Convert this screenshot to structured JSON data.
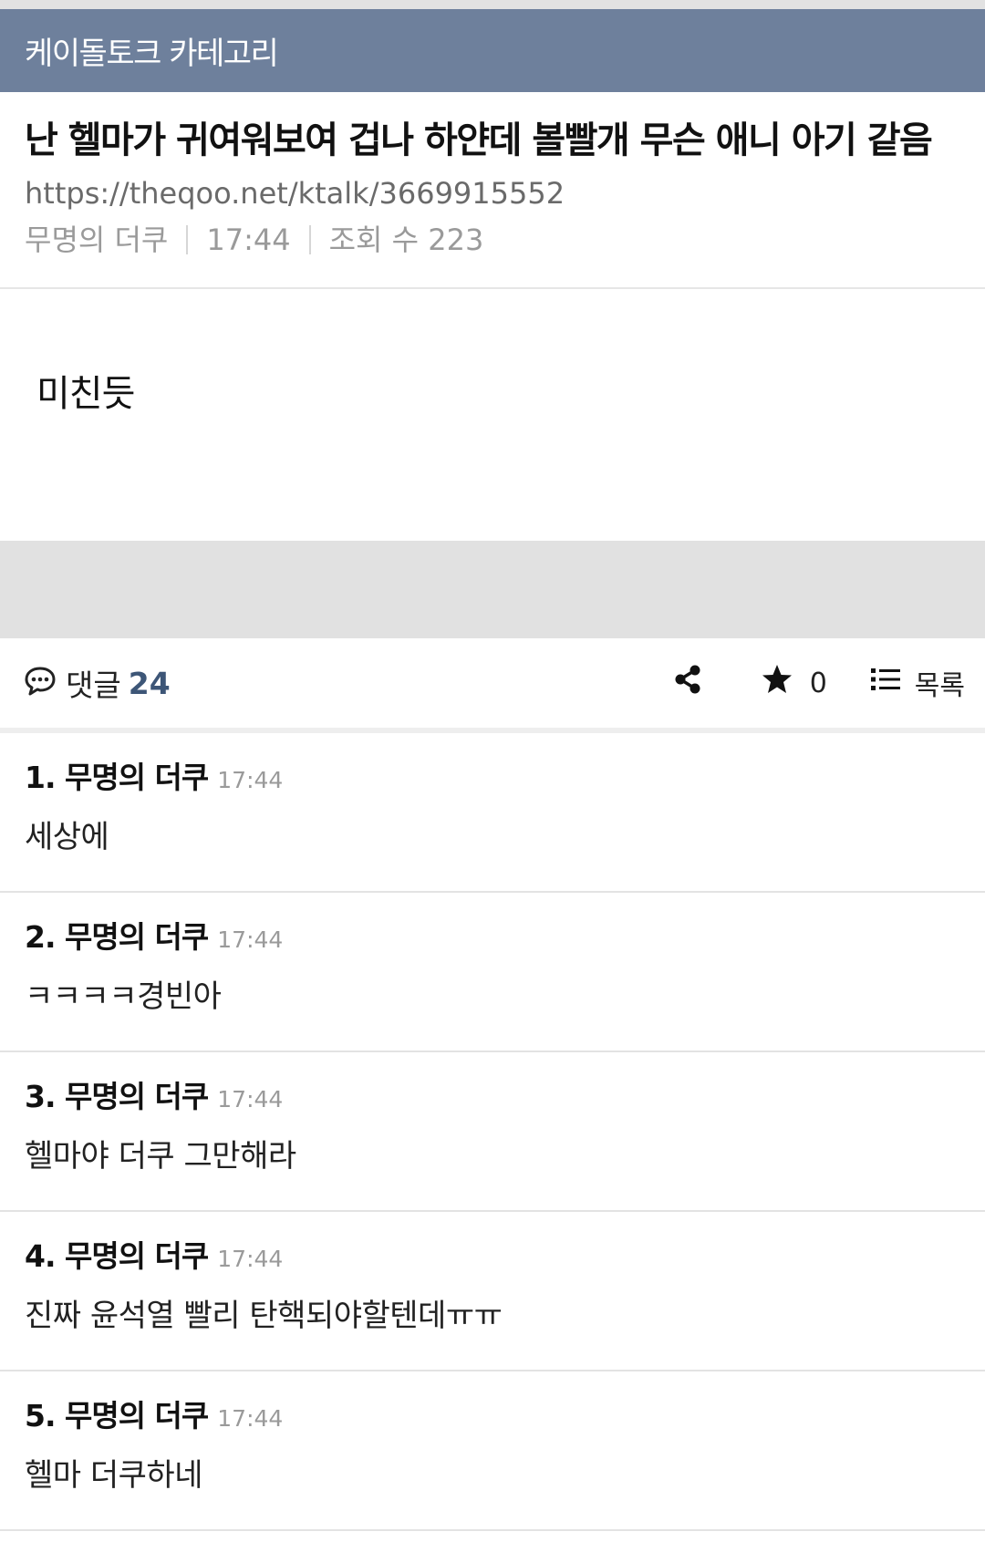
{
  "category": {
    "title": "케이돌토크 카테고리"
  },
  "post": {
    "title": "난 헬마가 귀여워보여 겁나 하얀데 볼빨개 무슨 애니 아기 같음",
    "url": "https://theqoo.net/ktalk/3669915552",
    "author": "무명의 더쿠",
    "time": "17:44",
    "views": "조회 수 223",
    "body": "미친듯"
  },
  "actions": {
    "comment_label": "댓글",
    "comment_count": "24",
    "star_count": "0",
    "list_label": "목록",
    "icons": [
      "comment-icon",
      "share-icon",
      "star-icon",
      "list-icon"
    ]
  },
  "comments": [
    {
      "author": "1. 무명의 더쿠",
      "time": "17:44",
      "text": "세상에"
    },
    {
      "author": "2. 무명의 더쿠",
      "time": "17:44",
      "text": "ㅋㅋㅋㅋ경빈아"
    },
    {
      "author": "3. 무명의 더쿠",
      "time": "17:44",
      "text": "헬마야 더쿠 그만해라"
    },
    {
      "author": "4. 무명의 더쿠",
      "time": "17:44",
      "text": "진짜 윤석열 빨리 탄핵되야할텐데ㅠㅠ"
    },
    {
      "author": "5. 무명의 더쿠",
      "time": "17:44",
      "text": "헬마 더쿠하네"
    }
  ],
  "colors": {
    "category_bar": "#6e809c",
    "comment_count": "#3d5677",
    "gap": "#e1e1e1"
  }
}
